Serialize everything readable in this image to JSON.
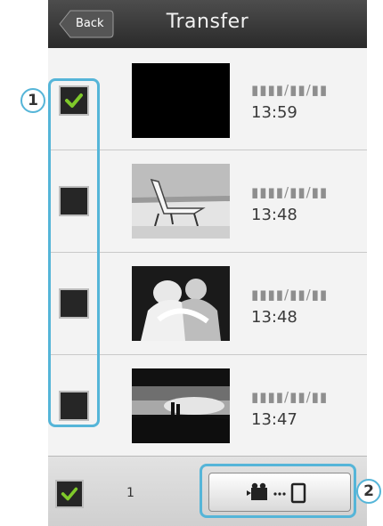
{
  "header": {
    "back_label": "Back",
    "title": "Transfer"
  },
  "files": [
    {
      "checked": true,
      "date_text": "▮▮▮▮/▮▮/▮▮",
      "time": "13:59",
      "thumb": "black-thumbnail"
    },
    {
      "checked": false,
      "date_text": "▮▮▮▮/▮▮/▮▮",
      "time": "13:48",
      "thumb": "beach-chair-thumbnail"
    },
    {
      "checked": false,
      "date_text": "▮▮▮▮/▮▮/▮▮",
      "time": "13:48",
      "thumb": "couple-thumbnail"
    },
    {
      "checked": false,
      "date_text": "▮▮▮▮/▮▮/▮▮",
      "time": "13:47",
      "thumb": "sunset-thumbnail"
    }
  ],
  "footer": {
    "select_all_checked": true,
    "selected_count": "1",
    "transfer_icon": "camera-to-phone-icon"
  },
  "callouts": [
    {
      "number": "1"
    },
    {
      "number": "2"
    }
  ],
  "colors": {
    "checkmark": "#7fc92a",
    "callout": "#55b5d8",
    "titlebar": "#3a3a3a"
  }
}
